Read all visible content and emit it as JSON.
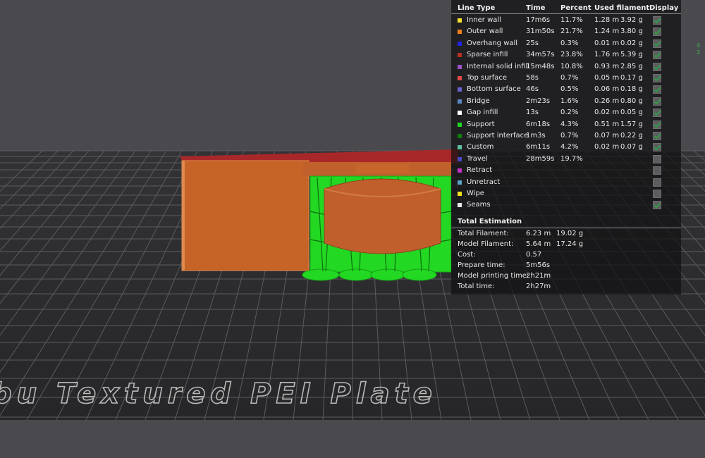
{
  "legend": {
    "headers": {
      "line_type": "Line Type",
      "time": "Time",
      "percent": "Percent",
      "used_filament": "Used filament",
      "display": "Display"
    },
    "rows": [
      {
        "name": "Inner wall",
        "color": "#f4e22d",
        "time": "17m6s",
        "percent": "11.7%",
        "length": "1.28 m",
        "weight": "3.92 g",
        "display": true
      },
      {
        "name": "Outer wall",
        "color": "#f0801c",
        "time": "31m50s",
        "percent": "21.7%",
        "length": "1.24 m",
        "weight": "3.80 g",
        "display": true
      },
      {
        "name": "Overhang wall",
        "color": "#2424e8",
        "time": "25s",
        "percent": "0.3%",
        "length": "0.01 m",
        "weight": "0.02 g",
        "display": true
      },
      {
        "name": "Sparse infill",
        "color": "#b83222",
        "time": "34m57s",
        "percent": "23.8%",
        "length": "1.76 m",
        "weight": "5.39 g",
        "display": true
      },
      {
        "name": "Internal solid infill",
        "color": "#9a52c4",
        "time": "15m48s",
        "percent": "10.8%",
        "length": "0.93 m",
        "weight": "2.85 g",
        "display": true
      },
      {
        "name": "Top surface",
        "color": "#e04a4a",
        "time": "58s",
        "percent": "0.7%",
        "length": "0.05 m",
        "weight": "0.17 g",
        "display": true
      },
      {
        "name": "Bottom surface",
        "color": "#6a62d0",
        "time": "46s",
        "percent": "0.5%",
        "length": "0.06 m",
        "weight": "0.18 g",
        "display": true
      },
      {
        "name": "Bridge",
        "color": "#5a86c0",
        "time": "2m23s",
        "percent": "1.6%",
        "length": "0.26 m",
        "weight": "0.80 g",
        "display": true
      },
      {
        "name": "Gap infill",
        "color": "#ffffff",
        "time": "13s",
        "percent": "0.2%",
        "length": "0.02 m",
        "weight": "0.05 g",
        "display": true
      },
      {
        "name": "Support",
        "color": "#22d822",
        "time": "6m18s",
        "percent": "4.3%",
        "length": "0.51 m",
        "weight": "1.57 g",
        "display": true
      },
      {
        "name": "Support interface",
        "color": "#127a12",
        "time": "1m3s",
        "percent": "0.7%",
        "length": "0.07 m",
        "weight": "0.22 g",
        "display": true
      },
      {
        "name": "Custom",
        "color": "#5ec0a0",
        "time": "6m11s",
        "percent": "4.2%",
        "length": "0.02 m",
        "weight": "0.07 g",
        "display": true
      },
      {
        "name": "Travel",
        "color": "#4848c8",
        "time": "28m59s",
        "percent": "19.7%",
        "length": "",
        "weight": "",
        "display": false
      },
      {
        "name": "Retract",
        "color": "#c430c4",
        "time": "",
        "percent": "",
        "length": "",
        "weight": "",
        "display": false
      },
      {
        "name": "Unretract",
        "color": "#5aa8c8",
        "time": "",
        "percent": "",
        "length": "",
        "weight": "",
        "display": false
      },
      {
        "name": "Wipe",
        "color": "#f0e020",
        "time": "",
        "percent": "",
        "length": "",
        "weight": "",
        "display": false
      },
      {
        "name": "Seams",
        "color": "#e8e8e8",
        "time": "",
        "percent": "",
        "length": "",
        "weight": "",
        "display": true
      }
    ]
  },
  "total": {
    "title": "Total Estimation",
    "rows": [
      {
        "label": "Total Filament:",
        "v1": "6.23 m",
        "v2": "19.02 g"
      },
      {
        "label": "Model Filament:",
        "v1": "5.64 m",
        "v2": "17.24 g"
      },
      {
        "label": "Cost:",
        "v1": "0.57",
        "v2": ""
      },
      {
        "label": "Prepare time:",
        "v1": "5m56s",
        "v2": ""
      },
      {
        "label": "Model printing time:",
        "v1": "2h21m",
        "v2": ""
      },
      {
        "label": "Total time:",
        "v1": "2h27m",
        "v2": ""
      }
    ]
  },
  "plate": {
    "label": "bu Textured PEI Plate"
  },
  "edge": {
    "line1": "4",
    "line2": "2"
  },
  "colors": {
    "background": "#4a4a4e",
    "bed": "#2d2d30",
    "grid": "#5a5a5e",
    "model": "#c8642a",
    "support": "#22d822",
    "top": "#b02a2a"
  }
}
